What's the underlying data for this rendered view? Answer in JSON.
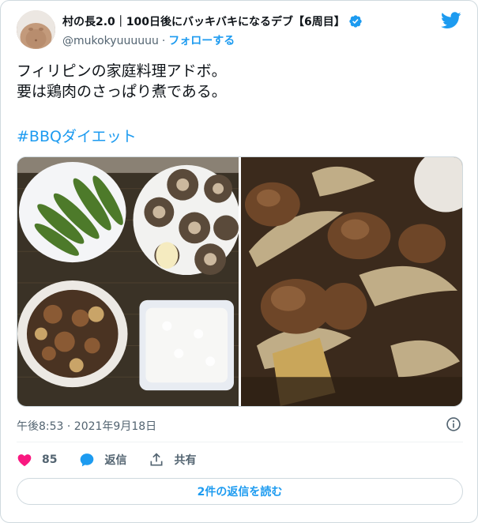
{
  "author": {
    "display_name": "村の長2.0｜100日後にバッキバキになるデブ【6周目】",
    "handle": "@mukokyuuuuuu",
    "separator": "·",
    "follow_label": "フォローする",
    "verified_icon": "verified-badge-icon"
  },
  "brand": {
    "logo_icon": "twitter-bird-icon",
    "accent": "#1d9bf0"
  },
  "tweet": {
    "text_line1": "フィリピンの家庭料理アドボ。",
    "text_line2": "要は鶏肉のさっぱり煮である。",
    "hashtag": "#BBQダイエット",
    "timestamp": "午後8:53 · 2021年9月18日"
  },
  "media": {
    "images": [
      "photo-okra-shiitake-rice-adobo-plate",
      "photo-adobo-closeup"
    ]
  },
  "actions": {
    "like_count": "85",
    "like_color": "#f91880",
    "reply_label": "返信",
    "share_label": "共有"
  },
  "replies_button": {
    "label": "2件の返信を読む"
  }
}
